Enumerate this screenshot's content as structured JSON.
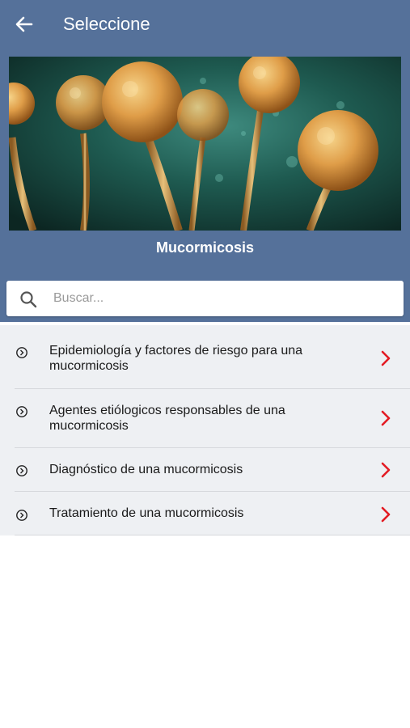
{
  "toolbar": {
    "title": "Seleccione",
    "back_icon": "arrow-left-icon"
  },
  "banner": {
    "caption": "Mucormicosis"
  },
  "search": {
    "placeholder": "Buscar...",
    "value": "",
    "icon": "search-icon"
  },
  "items": [
    {
      "label": "Epidemiología y factores de riesgo para una mucormicosis"
    },
    {
      "label": "Agentes etiólogicos responsables de una mucormicosis"
    },
    {
      "label": "Diagnóstico de una mucormicosis"
    },
    {
      "label": "Tratamiento de una mucormicosis"
    }
  ],
  "colors": {
    "header": "#55719a",
    "list_bg": "#eef0f3",
    "chevron": "#e31b23",
    "text": "#1a1a1a"
  }
}
